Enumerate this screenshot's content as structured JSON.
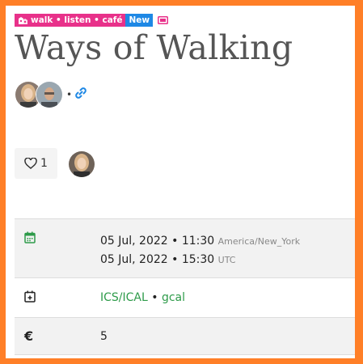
{
  "tags": {
    "group": "walk • listen • café",
    "new_badge": "New"
  },
  "event": {
    "title": "Ways of Walking",
    "separator": "•"
  },
  "likes": {
    "count": "1"
  },
  "details": {
    "start": {
      "datetime": "05 Jul, 2022 • 11:30",
      "tz": "America/New_York"
    },
    "end": {
      "datetime": "05 Jul, 2022 • 15:30",
      "tz": "UTC"
    },
    "calendar": {
      "ics": "ICS/ICAL",
      "sep": "•",
      "gcal": "gcal"
    },
    "price": {
      "currency": "€",
      "value": "5"
    }
  },
  "colors": {
    "frame": "#ff7f27",
    "tag": "#e8318a",
    "new": "#1e88e5",
    "link": "#2e9b4a",
    "calendar_icon": "#2e9b4a",
    "row_bg": "#f2f2f2"
  },
  "icons": [
    "walk-group-icon",
    "ticket-icon",
    "link-icon",
    "heart-icon",
    "calendar-icon",
    "calendar-add-icon",
    "euro-icon"
  ]
}
